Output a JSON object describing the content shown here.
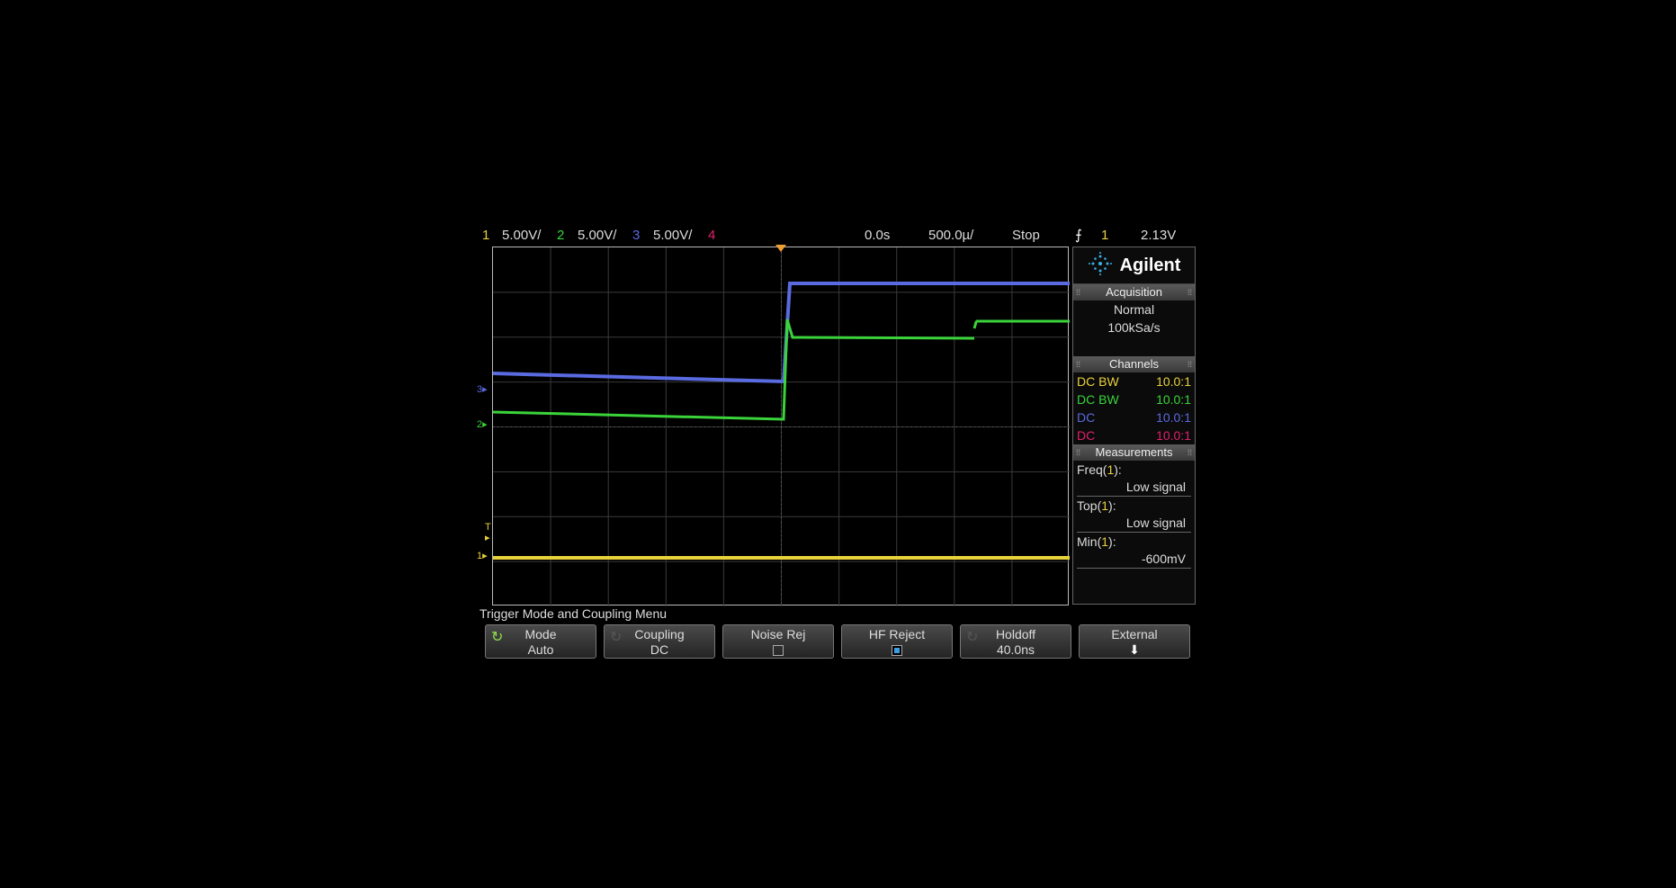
{
  "status_bar": {
    "ch1_num": "1",
    "ch1_scale": "5.00V/",
    "ch2_num": "2",
    "ch2_scale": "5.00V/",
    "ch3_num": "3",
    "ch3_scale": "5.00V/",
    "ch4_num": "4",
    "time_ref": "0.0s",
    "time_scale": "500.0µ/",
    "run_state": "Stop",
    "trigger_slope_icon": "falling-edge-icon",
    "trigger_source": "1",
    "trigger_level": "2.13V"
  },
  "markers": {
    "ch3": "3",
    "ch2": "2",
    "trigger": "T",
    "ch1": "1"
  },
  "colors": {
    "ch1": "#e8d23a",
    "ch2": "#3ad43a",
    "ch3": "#5a6ae0",
    "ch4": "#e0206a",
    "grid": "#3a3a3a",
    "trigger_marker": "#f0a030"
  },
  "side_panel": {
    "brand": "Agilent",
    "acquisition": {
      "title": "Acquisition",
      "mode": "Normal",
      "rate": "100kSa/s"
    },
    "channels": {
      "title": "Channels",
      "rows": [
        {
          "coupling": "DC BW",
          "probe": "10.0:1"
        },
        {
          "coupling": "DC BW",
          "probe": "10.0:1"
        },
        {
          "coupling": "DC",
          "probe": "10.0:1"
        },
        {
          "coupling": "DC",
          "probe": "10.0:1"
        }
      ]
    },
    "measurements": {
      "title": "Measurements",
      "items": [
        {
          "name": "Freq",
          "source": "1",
          "value": "Low signal"
        },
        {
          "name": "Top",
          "source": "1",
          "value": "Low signal"
        },
        {
          "name": "Min",
          "source": "1",
          "value": "-600mV"
        }
      ]
    }
  },
  "menu": {
    "title": "Trigger Mode and Coupling Menu",
    "softkeys": [
      {
        "label": "Mode",
        "value": "Auto"
      },
      {
        "label": "Coupling",
        "value": "DC"
      },
      {
        "label": "Noise Rej",
        "checked": false
      },
      {
        "label": "HF Reject",
        "checked": true
      },
      {
        "label": "Holdoff",
        "value": "40.0ns"
      },
      {
        "label": "External"
      }
    ]
  }
}
